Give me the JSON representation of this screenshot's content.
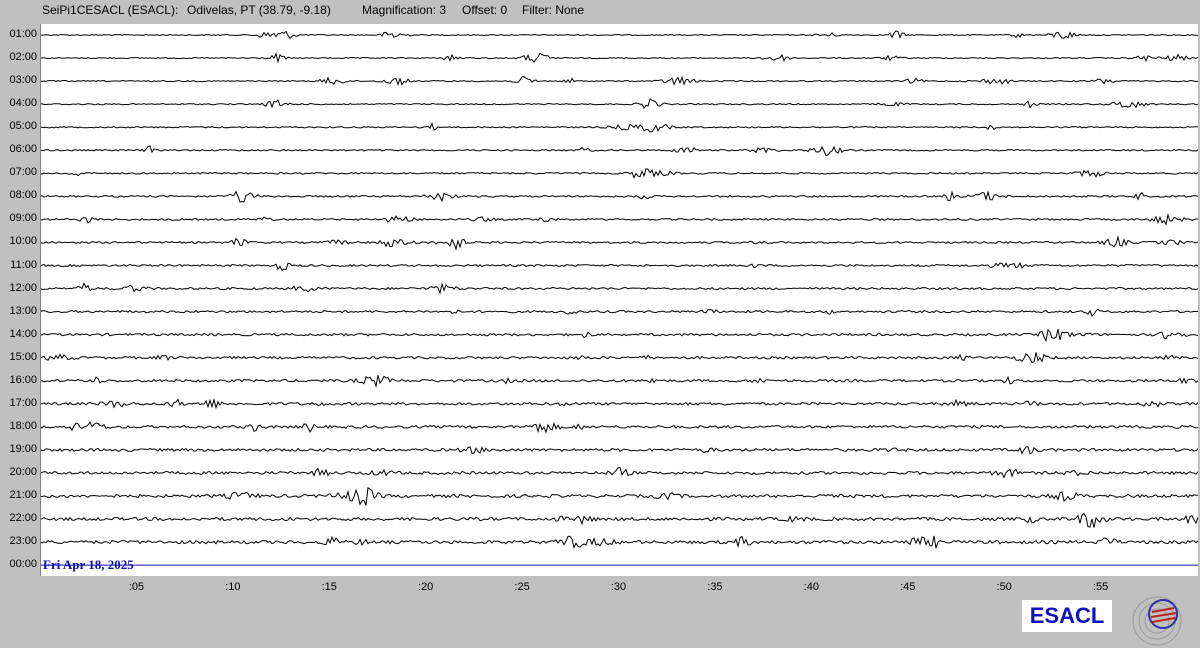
{
  "header": {
    "station": "SeiPi1CESACL (ESACL):",
    "location": "Odivelas, PT (38.79, -9.18)",
    "magnification": "Magnification: 3",
    "offset": "Offset: 0",
    "filter": "Filter: None"
  },
  "hours": [
    "01:00",
    "02:00",
    "03:00",
    "04:00",
    "05:00",
    "06:00",
    "07:00",
    "08:00",
    "09:00",
    "10:00",
    "11:00",
    "12:00",
    "13:00",
    "14:00",
    "15:00",
    "16:00",
    "17:00",
    "18:00",
    "19:00",
    "20:00",
    "21:00",
    "22:00",
    "23:00",
    "00:00"
  ],
  "minutes": [
    ":05",
    ":10",
    ":15",
    ":20",
    ":25",
    ":30",
    ":35",
    ":40",
    ":45",
    ":50",
    ":55"
  ],
  "date": "Fri Apr 18, 2025",
  "logo_text": "ESACL",
  "colors": {
    "trace": "#000000",
    "current_line": "#1010b0",
    "brand": "#1010c0",
    "background": "#c0c0c0"
  }
}
